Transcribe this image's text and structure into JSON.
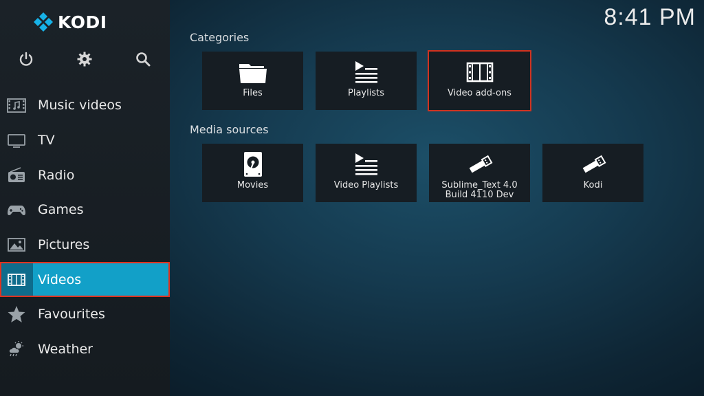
{
  "app": {
    "name": "KODI",
    "accent_color": "#12a0c8",
    "focus_border_color": "#e0321f"
  },
  "clock": {
    "time": "8:41 PM"
  },
  "top_icons": [
    {
      "name": "power-icon"
    },
    {
      "name": "settings-gear-icon"
    },
    {
      "name": "search-icon"
    }
  ],
  "sidebar": {
    "items": [
      {
        "label": "Music videos",
        "icon": "music-video-icon"
      },
      {
        "label": "TV",
        "icon": "tv-icon"
      },
      {
        "label": "Radio",
        "icon": "radio-icon"
      },
      {
        "label": "Games",
        "icon": "gamepad-icon"
      },
      {
        "label": "Pictures",
        "icon": "picture-icon"
      },
      {
        "label": "Videos",
        "icon": "film-icon",
        "active": true
      },
      {
        "label": "Favourites",
        "icon": "star-icon"
      },
      {
        "label": "Weather",
        "icon": "weather-icon"
      }
    ]
  },
  "categories": {
    "title": "Categories",
    "tiles": [
      {
        "label": "Files",
        "icon": "folder-icon"
      },
      {
        "label": "Playlists",
        "icon": "playlist-icon"
      },
      {
        "label": "Video add-ons",
        "icon": "film-strip-icon",
        "focused": true
      }
    ]
  },
  "media_sources": {
    "title": "Media sources",
    "tiles": [
      {
        "label": "Movies",
        "icon": "hard-drive-icon"
      },
      {
        "label": "Video Playlists",
        "icon": "playlist-icon"
      },
      {
        "label_line1": "Sublime_Text 4.0",
        "label_line2": "Build 4110 Dev",
        "icon": "usb-icon"
      },
      {
        "label": "Kodi",
        "icon": "usb-icon"
      }
    ]
  }
}
